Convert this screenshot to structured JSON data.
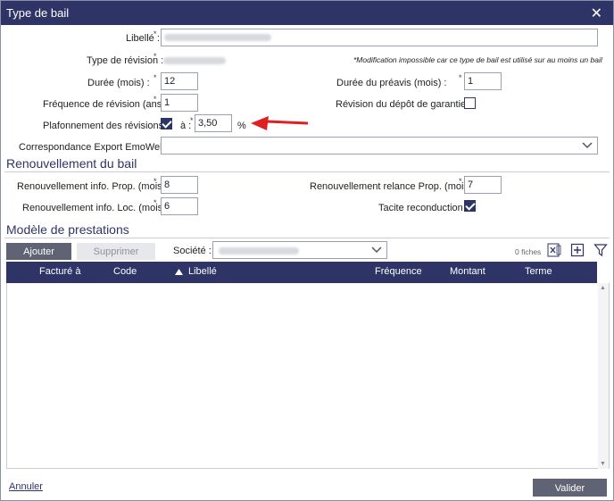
{
  "window": {
    "title": "Type de bail",
    "close_glyph": "✕"
  },
  "form": {
    "libelle_label": "Libellé :",
    "type_revision_label": "Type de révision :",
    "note": "*Modification impossible car ce type de bail est utilisé sur au moins un bail",
    "duree_label": "Durée (mois) :",
    "duree_value": "12",
    "duree_preavis_label": "Durée du préavis (mois) :",
    "duree_preavis_value": "1",
    "frequence_label": "Fréquence de révision (ans) :",
    "frequence_value": "1",
    "revision_depot_label": "Révision du dépôt de garantie :",
    "revision_depot_checked": false,
    "plafonnement_label": "Plafonnement des révisions :",
    "plafonnement_checked": true,
    "a_label": "à :",
    "pourcentage_value": "3,50",
    "pourcentage_unit": "%",
    "correspondance_label": "Correspondance Export EmoWeb :"
  },
  "renouvellement": {
    "title": "Renouvellement du bail",
    "info_prop_label": "Renouvellement info. Prop. (mois) :",
    "info_prop_value": "8",
    "relance_prop_label": "Renouvellement relance Prop. (mois) :",
    "relance_prop_value": "7",
    "info_loc_label": "Renouvellement info. Loc. (mois) :",
    "info_loc_value": "6",
    "tacite_label": "Tacite reconduction :",
    "tacite_checked": true
  },
  "prestations": {
    "title": "Modèle de prestations",
    "add_button": "Ajouter",
    "delete_button": "Supprimer",
    "societe_label": "Société :",
    "count_text": "0 fiches",
    "columns": [
      "Facturé à",
      "Code",
      "Libellé",
      "Fréquence",
      "Montant",
      "Terme"
    ],
    "sorted_column": "Libellé"
  },
  "footer": {
    "cancel": "Annuler",
    "validate": "Valider"
  },
  "colors": {
    "header": "#2e3566",
    "arrow": "#e02020",
    "button_dark": "#5f6373"
  },
  "icons": [
    "close-icon",
    "checkbox-icon",
    "chevron-down-icon",
    "arrow-annotation",
    "excel-export-icon",
    "add-row-icon",
    "filter-icon",
    "sort-up-icon"
  ]
}
